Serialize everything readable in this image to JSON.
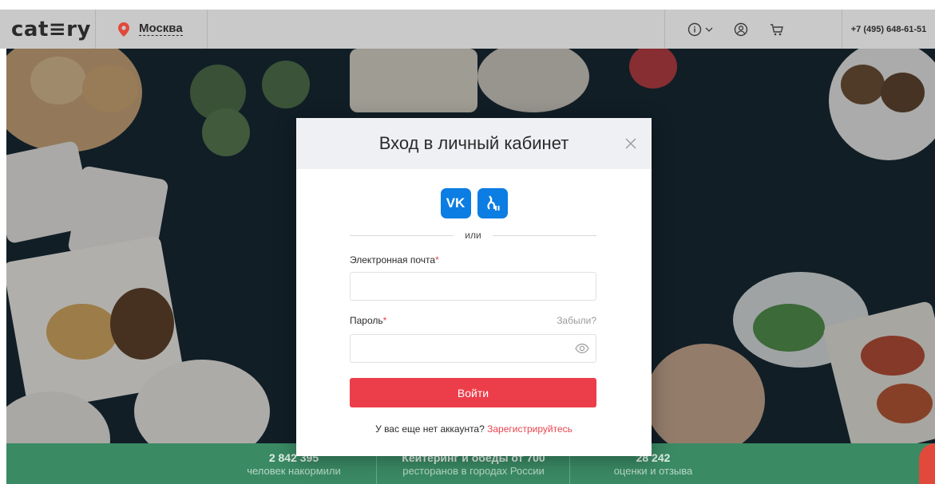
{
  "header": {
    "logo": "cat≡ry",
    "city": "Москва",
    "phone": "+7 (495) 648-61-51"
  },
  "icons": {
    "city": "map-pin-icon",
    "info": "info-icon",
    "account": "user-icon",
    "cart": "cart-icon"
  },
  "stats": [
    {
      "number": "2 842 395",
      "text": "человек накормили"
    },
    {
      "number": "Кейтеринг и обеды от 700",
      "text": "ресторанов в городах России"
    },
    {
      "number": "28 242",
      "text": "оценки и отзыва"
    }
  ],
  "login_modal": {
    "title": "Вход в личный кабинет",
    "social": [
      "VK",
      "Газпром ID"
    ],
    "or_label": "или",
    "email_label": "Электронная почта",
    "email_value": "",
    "password_label": "Пароль",
    "password_value": "",
    "required_mark": "*",
    "forgot_label": "Забыли?",
    "submit_label": "Войти",
    "register_prompt": "У вас еще нет аккаунта?",
    "register_link": "Зарегистрируйтесь"
  },
  "colors": {
    "accent": "#ec3e4a",
    "stats_band": "#3a8a64",
    "social_blue": "#0c7de2"
  }
}
